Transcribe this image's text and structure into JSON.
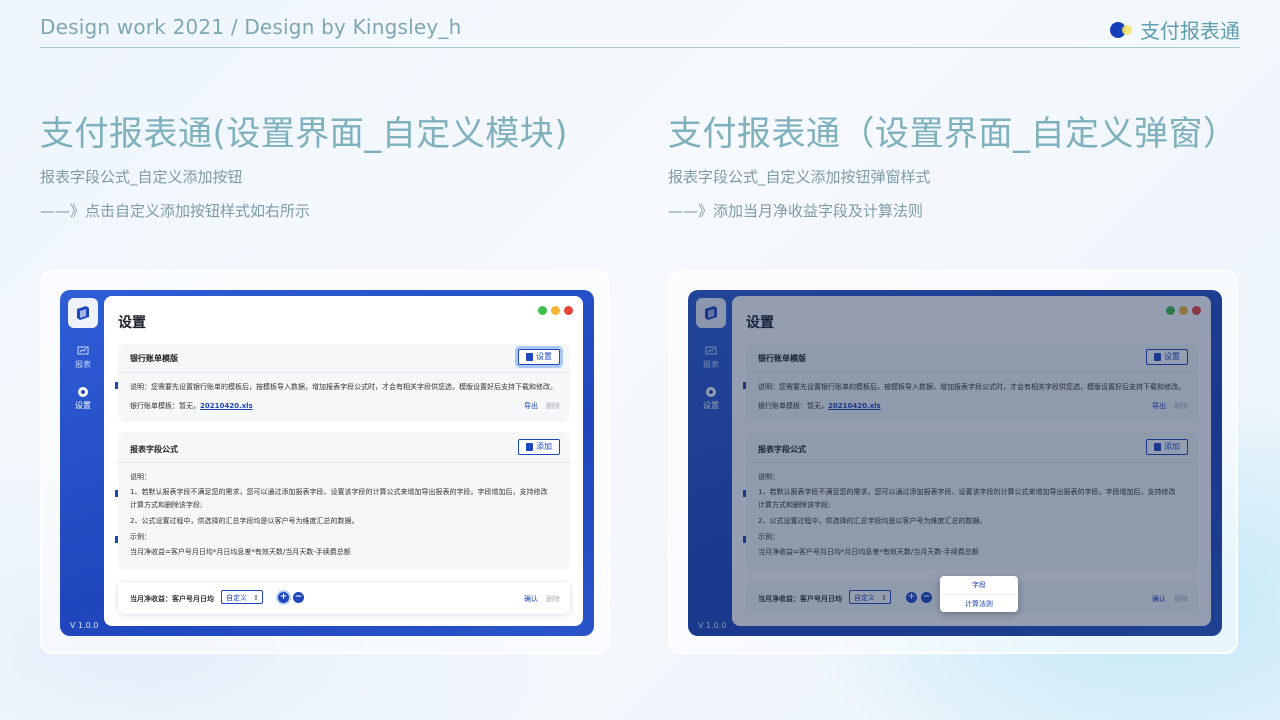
{
  "header": {
    "left_text": "Design work 2021 / Design by Kingsley_h",
    "right_text": "支付报表通"
  },
  "left": {
    "title": "支付报表通(设置界面_自定义模块)",
    "sub1": "报表字段公式_自定义添加按钮",
    "sub2": "——》点击自定义添加按钮样式如右所示"
  },
  "right": {
    "title": "支付报表通（设置界面_自定义弹窗）",
    "sub1": "报表字段公式_自定义添加按钮弹窗样式",
    "sub2": "——》添加当月净收益字段及计算法则"
  },
  "app": {
    "nav_report": "报表",
    "nav_settings": "设置",
    "version": "V 1.0.0",
    "panel_title": "设置",
    "card1": {
      "title": "银行账单模版",
      "button": "设置",
      "desc": "说明：您需要先设置银行账单的模板后，按模板导入数据，增加报表字段公式时，才会有相关字段供您选，模版设置好后支持下载和修改。",
      "template_label": "银行账单模板：暂无，",
      "template_file": "20210420.xls",
      "export": "导出",
      "delete": "删除"
    },
    "card2": {
      "title": "报表字段公式",
      "button": "添加",
      "desc_title": "说明：",
      "desc1": "1、若默认报表字段不满足您的需求，您可以通过添加报表字段、设置该字段的计算公式来增加导出报表的字段。字段增加后，支持修改",
      "desc1b": "计算方式和删除该字段;",
      "desc2": "2、公式设置过程中，供选择的汇总字段均是以客户号为维度汇总的数据。",
      "example_title": "示例：",
      "example": "当月净收益=客户号月日均*月日均息差*有效天数/当月天数-手续费总额"
    },
    "formula_row": {
      "label": "当月净收益：客户号月日均",
      "select_value": "自定义",
      "plus": "+",
      "minus": "−",
      "confirm": "确认",
      "delete": "删除"
    },
    "popup": {
      "item1": "字段",
      "item2": "计算法则"
    }
  },
  "colors": {
    "accent": "#1f46bd",
    "title": "#7fb0bd",
    "win_green": "#3fbf4a",
    "win_yellow": "#f5b731",
    "win_red": "#e8453c"
  }
}
